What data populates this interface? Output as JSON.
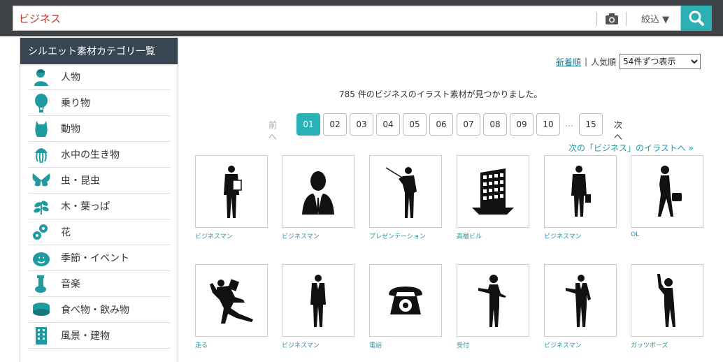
{
  "search": {
    "value": "ビジネス",
    "filter_label": "絞込 ▼"
  },
  "sidebar": {
    "title": "シルエット素材カテゴリ一覧",
    "items": [
      {
        "label": "人物",
        "icon": "person-icon"
      },
      {
        "label": "乗り物",
        "icon": "balloon-icon"
      },
      {
        "label": "動物",
        "icon": "animal-icon"
      },
      {
        "label": "水中の生き物",
        "icon": "jellyfish-icon"
      },
      {
        "label": "虫・昆虫",
        "icon": "butterfly-icon"
      },
      {
        "label": "木・葉っぱ",
        "icon": "leaf-icon"
      },
      {
        "label": "花",
        "icon": "flower-icon"
      },
      {
        "label": "季節・イベント",
        "icon": "pumpkin-icon"
      },
      {
        "label": "音楽",
        "icon": "tuba-icon"
      },
      {
        "label": "食べ物・飲み物",
        "icon": "food-icon"
      },
      {
        "label": "風景・建物",
        "icon": "building-icon"
      }
    ]
  },
  "sort": {
    "newest": "新着順",
    "separator": "|",
    "popular": "人気順",
    "per_page": "54件ずつ表示"
  },
  "result_text": "785 件のビジネスのイラスト素材が見つかりました。",
  "pagination": {
    "prev": "前へ",
    "pages": [
      "01",
      "02",
      "03",
      "04",
      "05",
      "06",
      "07",
      "08",
      "09",
      "10"
    ],
    "current": "01",
    "ellipsis": "…",
    "last": "15",
    "next": "次へ"
  },
  "next_category_link": "次の「ビジネス」のイラストへ »",
  "grid": [
    {
      "caption": "ビジネスマン",
      "icon": "businessman-document-icon"
    },
    {
      "caption": "ビジネスマン",
      "icon": "businessman-bust-icon"
    },
    {
      "caption": "プレゼンテーション",
      "icon": "presentation-icon"
    },
    {
      "caption": "高層ビル",
      "icon": "office-building-icon"
    },
    {
      "caption": "ビジネスマン",
      "icon": "businessman-bag-icon"
    },
    {
      "caption": "OL",
      "icon": "office-lady-icon"
    },
    {
      "caption": "走る",
      "icon": "running-man-icon"
    },
    {
      "caption": "ビジネスマン",
      "icon": "businessman-standing-icon"
    },
    {
      "caption": "電話",
      "icon": "telephone-icon"
    },
    {
      "caption": "受付",
      "icon": "receptionist-icon"
    },
    {
      "caption": "ビジネスマン",
      "icon": "businessman-pointing-icon"
    },
    {
      "caption": "ガッツポーズ",
      "icon": "fist-pump-icon"
    }
  ],
  "colors": {
    "accent": "#2bb0b6",
    "topbar": "#3f4247",
    "sidebar_header": "#384553",
    "caption": "#2a8fa4",
    "icon_teal": "#1f9aa0"
  }
}
